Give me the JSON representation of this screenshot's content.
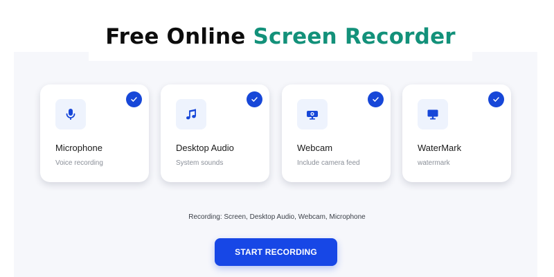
{
  "page": {
    "title_part1": "Free Online",
    "title_part2": "Screen Recorder"
  },
  "options": [
    {
      "label": "Microphone",
      "description": "Voice recording",
      "icon": "microphone-icon",
      "checked": true
    },
    {
      "label": "Desktop Audio",
      "description": "System sounds",
      "icon": "music-note-icon",
      "checked": true
    },
    {
      "label": "Webcam",
      "description": "Include camera feed",
      "icon": "webcam-icon",
      "checked": true
    },
    {
      "label": "WaterMark",
      "description": "watermark",
      "icon": "monitor-icon",
      "checked": true
    }
  ],
  "status": "Recording: Screen, Desktop Audio, Webcam, Microphone",
  "start_button": {
    "label": "START RECORDING"
  },
  "colors": {
    "accent": "#1747e6",
    "title_highlight": "#13917a",
    "panel_background": "#f6f7fb",
    "icon_background": "#eef3fd"
  }
}
